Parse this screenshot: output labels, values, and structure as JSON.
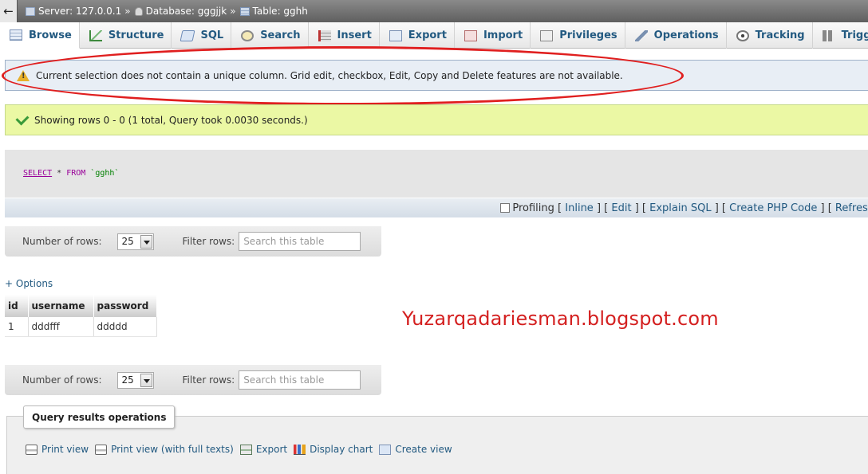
{
  "breadcrumb": {
    "back": "←",
    "server": "Server: 127.0.0.1",
    "database": "Database: gggjjk",
    "table": "Table: gghh",
    "separator": "»"
  },
  "tabs": [
    {
      "label": "Browse",
      "icon": "browse-icon",
      "active": true
    },
    {
      "label": "Structure",
      "icon": "structure-icon"
    },
    {
      "label": "SQL",
      "icon": "sql-icon"
    },
    {
      "label": "Search",
      "icon": "search-icon"
    },
    {
      "label": "Insert",
      "icon": "insert-icon"
    },
    {
      "label": "Export",
      "icon": "export-icon"
    },
    {
      "label": "Import",
      "icon": "import-icon"
    },
    {
      "label": "Privileges",
      "icon": "privileges-icon"
    },
    {
      "label": "Operations",
      "icon": "operations-icon"
    },
    {
      "label": "Tracking",
      "icon": "tracking-icon"
    },
    {
      "label": "Triggers",
      "icon": "triggers-icon"
    }
  ],
  "warning": {
    "text": "Current selection does not contain a unique column. Grid edit, checkbox, Edit, Copy and Delete features are not available.",
    "icon": "warning-icon"
  },
  "success": {
    "text": "Showing rows 0 - 0 (1 total, Query took 0.0030 seconds.)",
    "icon": "check-icon"
  },
  "sql": {
    "select": "SELECT",
    "star": " * ",
    "from": "FROM",
    "table": " `gghh`"
  },
  "sql_bar": {
    "profiling": "Profiling",
    "inline": "Inline",
    "edit": "Edit",
    "explain": "Explain SQL",
    "php": "Create PHP Code",
    "refresh": "Refresh",
    "open": "[",
    "close": "]",
    "mid": "] ["
  },
  "row_controls": {
    "rows_label": "Number of rows:",
    "rows_value": "25",
    "filter_label": "Filter rows:",
    "filter_placeholder": "Search this table"
  },
  "options_link": "+ Options",
  "table": {
    "columns": [
      "id",
      "username",
      "password"
    ],
    "rows": [
      [
        "1",
        "dddfff",
        "ddddd"
      ]
    ]
  },
  "watermark": "Yuzarqadariesman.blogspot.com",
  "query_ops": {
    "title": "Query results operations",
    "links": [
      {
        "label": "Print view",
        "icon": "print-icon"
      },
      {
        "label": "Print view (with full texts)",
        "icon": "print-icon"
      },
      {
        "label": "Export",
        "icon": "export-icon"
      },
      {
        "label": "Display chart",
        "icon": "chart-icon"
      },
      {
        "label": "Create view",
        "icon": "view-icon"
      }
    ]
  },
  "colors": {
    "link": "#235a81",
    "warning_bg": "#e8eef5",
    "success_bg": "#ebf8a4",
    "annotation_red": "#e01f1f"
  }
}
